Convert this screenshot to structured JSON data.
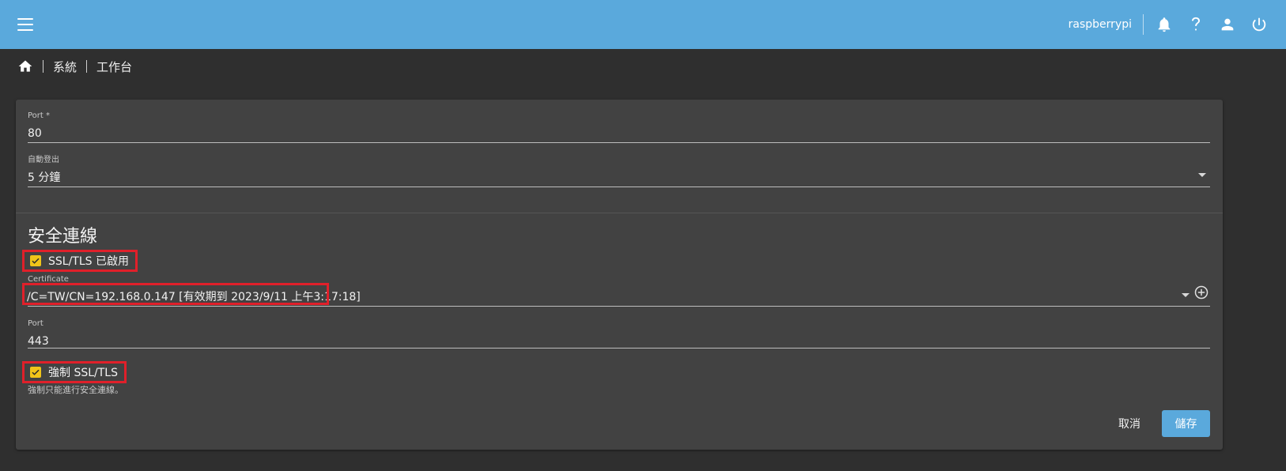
{
  "topbar": {
    "hostname": "raspberrypi",
    "accent_color": "#5aa9dc",
    "icons": [
      "menu-icon",
      "bell-icon",
      "help-icon",
      "user-icon",
      "power-icon"
    ]
  },
  "breadcrumb": {
    "home_icon": "home-icon",
    "items": [
      "系統",
      "工作台"
    ]
  },
  "form": {
    "port": {
      "label": "Port *",
      "value": "80"
    },
    "auto_logout": {
      "label": "自動登出",
      "value": "5 分鐘"
    },
    "section_title": "安全連線",
    "ssl_enabled": {
      "label": "SSL/TLS 已啟用",
      "checked": true
    },
    "certificate": {
      "label": "Certificate",
      "value": "/C=TW/CN=192.168.0.147 [有效期到 2023/9/11 上午3:17:18]"
    },
    "ssl_port": {
      "label": "Port",
      "value": "443"
    },
    "force_ssl": {
      "label": "強制 SSL/TLS",
      "checked": true,
      "hint": "強制只能進行安全連線。"
    }
  },
  "actions": {
    "cancel_label": "取消",
    "save_label": "儲存"
  },
  "colors": {
    "highlight_border": "#e0202a",
    "checkbox_fill": "#f0c419",
    "card_background": "#424242",
    "page_background": "#2f2f2f"
  }
}
